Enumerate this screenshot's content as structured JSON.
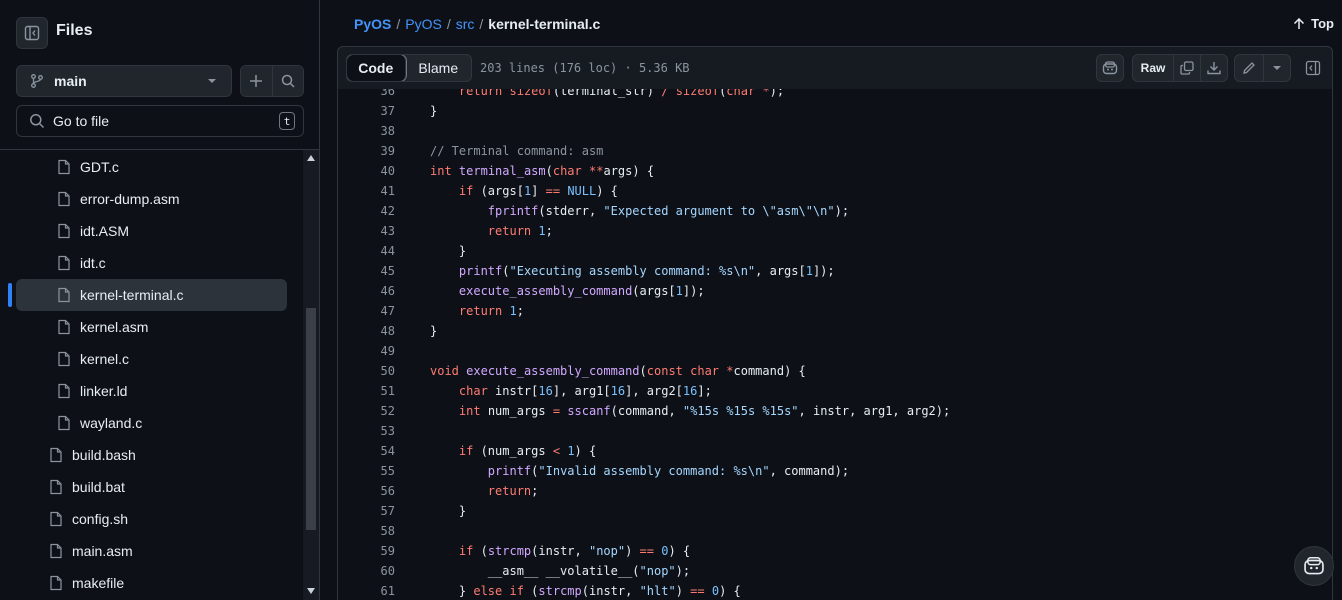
{
  "sidebar": {
    "title": "Files",
    "branch": "main",
    "goto_placeholder": "Go to file",
    "goto_shortcut": "t",
    "tree": [
      {
        "name": "GDT.c",
        "indent": 2
      },
      {
        "name": "error-dump.asm",
        "indent": 2
      },
      {
        "name": "idt.ASM",
        "indent": 2
      },
      {
        "name": "idt.c",
        "indent": 2
      },
      {
        "name": "kernel-terminal.c",
        "indent": 2,
        "active": true
      },
      {
        "name": "kernel.asm",
        "indent": 2
      },
      {
        "name": "kernel.c",
        "indent": 2
      },
      {
        "name": "linker.ld",
        "indent": 2
      },
      {
        "name": "wayland.c",
        "indent": 2
      },
      {
        "name": "build.bash",
        "indent": 1
      },
      {
        "name": "build.bat",
        "indent": 1
      },
      {
        "name": "config.sh",
        "indent": 1
      },
      {
        "name": "main.asm",
        "indent": 1
      },
      {
        "name": "makefile",
        "indent": 1
      }
    ]
  },
  "breadcrumb": {
    "repo": "PyOS",
    "folder1": "PyOS",
    "folder2": "src",
    "file": "kernel-terminal.c",
    "separator": "/"
  },
  "top_label": "Top",
  "file_header": {
    "tabs": [
      "Code",
      "Blame"
    ],
    "active_tab": "Code",
    "meta": "203 lines (176 loc) · 5.36 KB",
    "raw_label": "Raw"
  },
  "code": {
    "first_line_partial": "    return sizeof(terminal_str) / sizeof(char *);",
    "lines": [
      {
        "n": "36",
        "t": "    return sizeof(terminal_str) / sizeof(char *);"
      },
      {
        "n": "37",
        "t": "}"
      },
      {
        "n": "38",
        "t": ""
      },
      {
        "n": "39",
        "t": "// Terminal command: asm"
      },
      {
        "n": "40",
        "t": "int terminal_asm(char **args) {"
      },
      {
        "n": "41",
        "t": "    if (args[1] == NULL) {"
      },
      {
        "n": "42",
        "t": "        fprintf(stderr, \"Expected argument to \\\"asm\\\"\\n\");"
      },
      {
        "n": "43",
        "t": "        return 1;"
      },
      {
        "n": "44",
        "t": "    }"
      },
      {
        "n": "45",
        "t": "    printf(\"Executing assembly command: %s\\n\", args[1]);"
      },
      {
        "n": "46",
        "t": "    execute_assembly_command(args[1]);"
      },
      {
        "n": "47",
        "t": "    return 1;"
      },
      {
        "n": "48",
        "t": "}"
      },
      {
        "n": "49",
        "t": ""
      },
      {
        "n": "50",
        "t": "void execute_assembly_command(const char *command) {"
      },
      {
        "n": "51",
        "t": "    char instr[16], arg1[16], arg2[16];"
      },
      {
        "n": "52",
        "t": "    int num_args = sscanf(command, \"%15s %15s %15s\", instr, arg1, arg2);"
      },
      {
        "n": "53",
        "t": ""
      },
      {
        "n": "54",
        "t": "    if (num_args < 1) {"
      },
      {
        "n": "55",
        "t": "        printf(\"Invalid assembly command: %s\\n\", command);"
      },
      {
        "n": "56",
        "t": "        return;"
      },
      {
        "n": "57",
        "t": "    }"
      },
      {
        "n": "58",
        "t": ""
      },
      {
        "n": "59",
        "t": "    if (strcmp(instr, \"nop\") == 0) {"
      },
      {
        "n": "60",
        "t": "        __asm__ __volatile__(\"nop\");"
      },
      {
        "n": "61",
        "t": "    } else if (strcmp(instr, \"hlt\") == 0) {"
      }
    ]
  },
  "colors": {
    "background": "#0d1117",
    "accent": "#2f81f7",
    "link": "#4493f8",
    "keyword": "#ff7b72",
    "function": "#d2a8ff",
    "string": "#a5d6ff",
    "number": "#79c0ff",
    "comment": "#8b949e"
  }
}
